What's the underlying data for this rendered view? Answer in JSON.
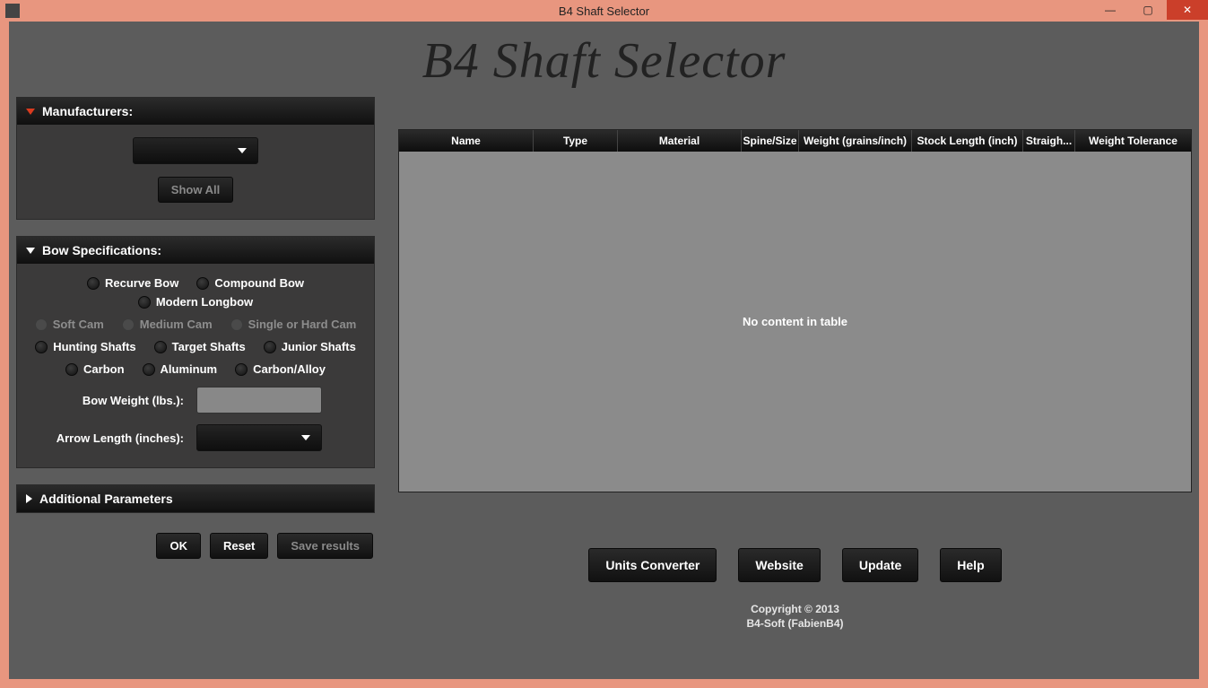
{
  "window": {
    "title": "B4 Shaft Selector"
  },
  "appTitle": "B4 Shaft Selector",
  "panels": {
    "manufacturers": {
      "title": "Manufacturers:",
      "showAll": "Show All"
    },
    "bowSpec": {
      "title": "Bow Specifications:",
      "bowTypes": [
        "Recurve Bow",
        "Compound Bow",
        "Modern Longbow"
      ],
      "cams": [
        "Soft Cam",
        "Medium Cam",
        "Single or Hard Cam"
      ],
      "shafts": [
        "Hunting Shafts",
        "Target Shafts",
        "Junior Shafts"
      ],
      "materials": [
        "Carbon",
        "Aluminum",
        "Carbon/Alloy"
      ],
      "bowWeightLabel": "Bow Weight (lbs.):",
      "arrowLengthLabel": "Arrow Length (inches):"
    },
    "additional": {
      "title": "Additional Parameters"
    }
  },
  "actions": {
    "ok": "OK",
    "reset": "Reset",
    "save": "Save results"
  },
  "table": {
    "headers": [
      "Name",
      "Type",
      "Material",
      "Spine/Size",
      "Weight (grains/inch)",
      "Stock Length (inch)",
      "Straigh...",
      "Weight Tolerance"
    ],
    "empty": "No content in table"
  },
  "footer": {
    "buttons": [
      "Units Converter",
      "Website",
      "Update",
      "Help"
    ],
    "copyright1": "Copyright © 2013",
    "copyright2": "B4-Soft (FabienB4)"
  }
}
